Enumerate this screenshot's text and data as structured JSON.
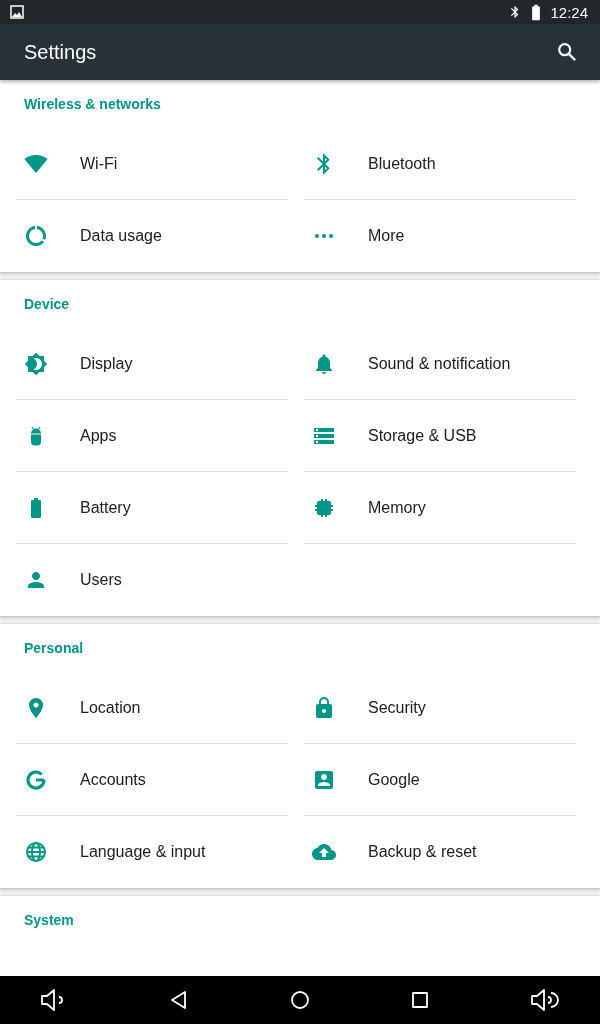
{
  "status_bar": {
    "time": "12:24"
  },
  "app_bar": {
    "title": "Settings"
  },
  "sections": [
    {
      "title": "Wireless & networks",
      "items": [
        "Wi‑Fi",
        "Bluetooth",
        "Data usage",
        "More"
      ]
    },
    {
      "title": "Device",
      "items": [
        "Display",
        "Sound & notification",
        "Apps",
        "Storage & USB",
        "Battery",
        "Memory",
        "Users"
      ]
    },
    {
      "title": "Personal",
      "items": [
        "Location",
        "Security",
        "Accounts",
        "Google",
        "Language & input",
        "Backup & reset"
      ]
    },
    {
      "title": "System"
    }
  ]
}
